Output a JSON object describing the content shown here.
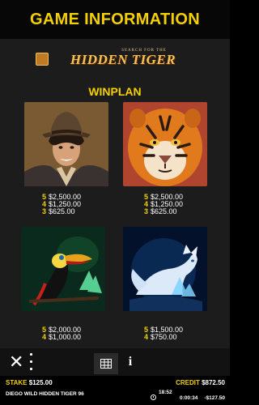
{
  "header": {
    "title": "GAME INFORMATION"
  },
  "logo": {
    "tagline": "SEARCH FOR THE",
    "name": "HIDDEN TIGER"
  },
  "section": {
    "title": "WINPLAN"
  },
  "symbols": [
    {
      "name": "explorer",
      "payouts": [
        {
          "count": "5",
          "amount": "$2,500.00"
        },
        {
          "count": "4",
          "amount": "$1,250.00"
        },
        {
          "count": "3",
          "amount": "$625.00"
        }
      ]
    },
    {
      "name": "tiger",
      "payouts": [
        {
          "count": "5",
          "amount": "$2,500.00"
        },
        {
          "count": "4",
          "amount": "$1,250.00"
        },
        {
          "count": "3",
          "amount": "$625.00"
        }
      ]
    },
    {
      "name": "toucan",
      "payouts": [
        {
          "count": "5",
          "amount": "$2,000.00"
        },
        {
          "count": "4",
          "amount": "$1,000.00"
        }
      ]
    },
    {
      "name": "arctic-fox",
      "payouts": [
        {
          "count": "5",
          "amount": "$1,500.00"
        },
        {
          "count": "4",
          "amount": "$750.00"
        }
      ]
    }
  ],
  "toolbar": {
    "close_icon": "close-icon",
    "menu_icon": "more-vertical-icon",
    "paytable_icon": "table-icon",
    "info_icon": "info-icon",
    "close_glyph": "✕",
    "info_glyph": "i"
  },
  "status": {
    "stake_label": "STAKE",
    "stake_value": "$125.00",
    "credit_label": "CREDIT",
    "credit_value": "$872.50",
    "game_name": "DIEGO WILD HIDDEN TIGER 96",
    "time": "18:52",
    "session_time": "0:00:34",
    "session_result": "-$127.50"
  },
  "colors": {
    "accent": "#f5d000",
    "background": "#1c1c1c",
    "header": "#070707"
  }
}
